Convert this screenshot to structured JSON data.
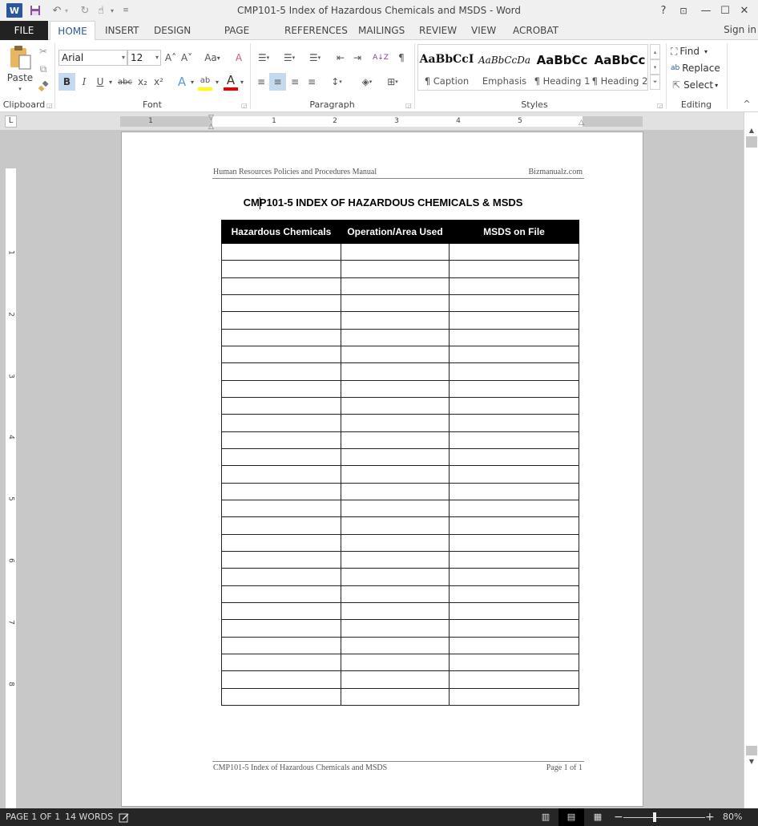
{
  "window": {
    "title": "CMP101-5 Index of Hazardous Chemicals and MSDS - Word",
    "app_icon": "W",
    "controls": {
      "help": "?",
      "ribbon_options": "⊡",
      "minimize": "—",
      "maximize": "☐",
      "close": "✕"
    }
  },
  "quick_access": {
    "save": "💾",
    "undo": "↶",
    "dropdown": "▾",
    "redo": "↻",
    "touch_mode": "☝",
    "customize": "≡"
  },
  "tabs": [
    {
      "label": "FILE"
    },
    {
      "label": "HOME",
      "active": true
    },
    {
      "label": "INSERT"
    },
    {
      "label": "DESIGN"
    },
    {
      "label": "PAGE LAYOUT"
    },
    {
      "label": "REFERENCES"
    },
    {
      "label": "MAILINGS"
    },
    {
      "label": "REVIEW"
    },
    {
      "label": "VIEW"
    },
    {
      "label": "ACROBAT"
    }
  ],
  "sign_in": "Sign in",
  "ribbon": {
    "clipboard": {
      "label": "Clipboard",
      "paste": "Paste",
      "paste_drop": "▾",
      "cut": "✂",
      "copy": "⧉",
      "format_painter": "🖌"
    },
    "font": {
      "label": "Font",
      "font_name": "Arial",
      "font_size": "12",
      "grow": "A˄",
      "shrink": "A˅",
      "change_case": "Aa",
      "clear_format": "A",
      "bold": "B",
      "italic": "I",
      "underline": "U",
      "strikethrough": "abc",
      "subscript": "x₂",
      "superscript": "x²",
      "text_effects": "A",
      "highlight": "ab",
      "font_color": "A",
      "highlight_color": "#ffff00",
      "font_color_value": "#ff0000"
    },
    "paragraph": {
      "label": "Paragraph",
      "bullets": "☰",
      "numbering": "☰",
      "multilevel": "☰",
      "decrease_indent": "⇤",
      "increase_indent": "⇥",
      "sort": "A↓Z",
      "show_marks": "¶",
      "align_left": "≡",
      "align_center": "≡",
      "align_right": "≡",
      "justify": "≡",
      "line_spacing": "↕",
      "shading": "◈",
      "borders": "⊞"
    },
    "styles": {
      "label": "Styles",
      "items": [
        {
          "sample": "AaBbCcI",
          "name": "¶ Caption"
        },
        {
          "sample": "AaBbCcDa",
          "name": "Emphasis"
        },
        {
          "sample": "AaBbCc",
          "name": "¶ Heading 1"
        },
        {
          "sample": "AaBbCc",
          "name": "¶ Heading 2"
        }
      ],
      "scroll_up": "▴",
      "scroll_down": "▾",
      "more": "⏷"
    },
    "editing": {
      "label": "Editing",
      "find": "Find",
      "replace": "Replace",
      "select": "Select",
      "collapse": "^"
    }
  },
  "ruler": {
    "tab_selector": "L",
    "numbers": [
      "1",
      "1",
      "2",
      "3",
      "4",
      "5"
    ],
    "v_numbers": [
      "1",
      "2",
      "3",
      "4",
      "5",
      "6",
      "7",
      "8"
    ]
  },
  "document": {
    "header_left": "Human Resources Policies and Procedures Manual",
    "header_right": "Bizmanualz.com",
    "title": "CMP101-5 INDEX OF HAZARDOUS CHEMICALS & MSDS",
    "table": {
      "headers": [
        "Hazardous Chemicals",
        "Operation/Area Used",
        "MSDS on File"
      ],
      "empty_rows": 27
    },
    "footer_left": "CMP101-5 Index of Hazardous Chemicals and MSDS",
    "footer_right": "Page 1 of 1"
  },
  "status": {
    "page": "PAGE 1 OF 1",
    "words": "14 WORDS",
    "proofing": "📝",
    "read_mode": "▥",
    "print_layout": "▤",
    "web_layout": "▦",
    "zoom_out": "−",
    "zoom_in": "+",
    "zoom_level": "80%",
    "zoom_percent": 80
  }
}
